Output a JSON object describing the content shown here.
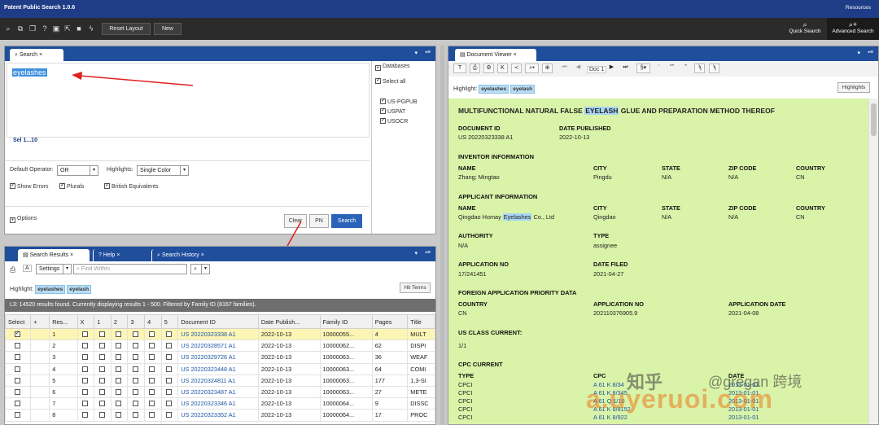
{
  "app": {
    "title": "Patent Public Search 1.0.6",
    "resources": "Resources"
  },
  "toolbar": {
    "reset_layout": "Reset Layout",
    "new": "New",
    "quick_search": "Quick Search",
    "advanced_search": "Advanced Search"
  },
  "search_panel": {
    "tab": "Search",
    "query": "eyelashes",
    "sel_text": "Sel 1...10",
    "default_operator_label": "Default Operator:",
    "default_operator": "OR",
    "highlights_label": "Highlights:",
    "highlights": "Single Color",
    "show_errors": "Show Errors",
    "plurals": "Plurals",
    "british": "British Equivalents",
    "options": "Options",
    "clear": "Clear",
    "pn": "PN",
    "search": "Search",
    "databases_label": "Databases",
    "select_all": "Select all",
    "databases": [
      "US-PGPUB",
      "USPAT",
      "USOCR"
    ]
  },
  "results_panel": {
    "tabs": [
      "Search Results",
      "Help",
      "Search History"
    ],
    "settings": "Settings",
    "find_placeholder": "Find Within",
    "highlight_label": "Highlight:",
    "highlight_terms": [
      "eyelashes",
      "eyelash"
    ],
    "hit_terms": "Hit Terms",
    "status": "L3: 14520 results found. Currently displaying results 1 - 500. Filtered by Family ID (8167 families).",
    "columns": [
      "Select",
      "+",
      "Res...",
      "X",
      "1",
      "2",
      "3",
      "4",
      "5",
      "Document ID",
      "Date Publish...",
      "Family ID",
      "Pages",
      "Title"
    ],
    "rows": [
      {
        "n": "1",
        "doc": "US 20220323338 A1",
        "date": "2022-10-13",
        "fam": "10000055...",
        "pages": "4",
        "title": "MULT",
        "checked": true
      },
      {
        "n": "2",
        "doc": "US 20220328571 A1",
        "date": "2022-10-13",
        "fam": "10000062...",
        "pages": "62",
        "title": "DISPI",
        "checked": false
      },
      {
        "n": "3",
        "doc": "US 20220329726 A1",
        "date": "2022-10-13",
        "fam": "10000063...",
        "pages": "36",
        "title": "WEAF",
        "checked": false
      },
      {
        "n": "4",
        "doc": "US 20220323448 A1",
        "date": "2022-10-13",
        "fam": "10000063...",
        "pages": "64",
        "title": "COMI",
        "checked": false
      },
      {
        "n": "5",
        "doc": "US 20220324811 A1",
        "date": "2022-10-13",
        "fam": "10000063...",
        "pages": "177",
        "title": "1,3-SI",
        "checked": false
      },
      {
        "n": "6",
        "doc": "US 20220323487 A1",
        "date": "2022-10-13",
        "fam": "10000063...",
        "pages": "27",
        "title": "METE",
        "checked": false
      },
      {
        "n": "7",
        "doc": "US 20220323346 A1",
        "date": "2022-10-13",
        "fam": "10000064...",
        "pages": "9",
        "title": "DISSC",
        "checked": false
      },
      {
        "n": "8",
        "doc": "US 20220323352 A1",
        "date": "2022-10-13",
        "fam": "10000064...",
        "pages": "17",
        "title": "PROC",
        "checked": false
      }
    ]
  },
  "viewer": {
    "tab": "Document Viewer",
    "doc_label": "Doc 1",
    "highlight_label": "Highlight:",
    "highlight_terms": [
      "eyelashes",
      "eyelash"
    ],
    "highlights_btn": "Highlights",
    "title_pre": "MULTIFUNCTIONAL NATURAL FALSE ",
    "title_hl": "EYELASH",
    "title_post": " GLUE AND PREPARATION METHOD THEREOF",
    "doc_id_label": "DOCUMENT ID",
    "doc_id": "US 20220323338 A1",
    "date_pub_label": "DATE PUBLISHED",
    "date_pub": "2022-10-13",
    "inventor_header": "INVENTOR INFORMATION",
    "name_label": "NAME",
    "city_label": "CITY",
    "state_label": "STATE",
    "zip_label": "ZIP CODE",
    "country_label": "COUNTRY",
    "inv_name": "Zhang; Mingtao",
    "inv_city": "Pingdu",
    "inv_state": "N/A",
    "inv_zip": "N/A",
    "inv_country": "CN",
    "applicant_header": "APPLICANT INFORMATION",
    "app_name_pre": "Qingdao Homay ",
    "app_name_hl": "Eyelashes",
    "app_name_post": " Co., Ltd",
    "app_city": "Qingdao",
    "app_state": "N/A",
    "app_zip": "N/A",
    "app_country": "CN",
    "authority_label": "AUTHORITY",
    "authority": "N/A",
    "type_label": "TYPE",
    "type": "assignee",
    "appno_label": "APPLICATION NO",
    "appno": "17/241451",
    "date_filed_label": "DATE FILED",
    "date_filed": "2021-04-27",
    "foreign_header": "FOREIGN APPLICATION PRIORITY DATA",
    "f_country_label": "COUNTRY",
    "f_appno_label": "APPLICATION NO",
    "f_date_label": "APPLICATION DATE",
    "f_country": "CN",
    "f_appno": "202110376905.9",
    "f_date": "2021-04-08",
    "usclass_header": "US CLASS CURRENT:",
    "usclass": "1/1",
    "cpc_header": "CPC CURRENT",
    "cpc_type_label": "TYPE",
    "cpc_label": "CPC",
    "cpc_date_label": "DATE",
    "cpc_rows": [
      [
        "CPCI",
        "A 61 K 8/34",
        "2013-01-01"
      ],
      [
        "CPCI",
        "A 61 K 8/345",
        "2013-01-01"
      ],
      [
        "CPCI",
        "A 61 Q 1/10",
        "2013-01-01"
      ],
      [
        "CPCI",
        "A 61 K 8/8152",
        "2013-01-01"
      ],
      [
        "CPCI",
        "A 61 K 8/922",
        "2013-01-01"
      ]
    ]
  },
  "watermark": {
    "text1": "知乎",
    "text2": "@gregan 跨境",
    "text3": "a.uyeruoi.com"
  }
}
